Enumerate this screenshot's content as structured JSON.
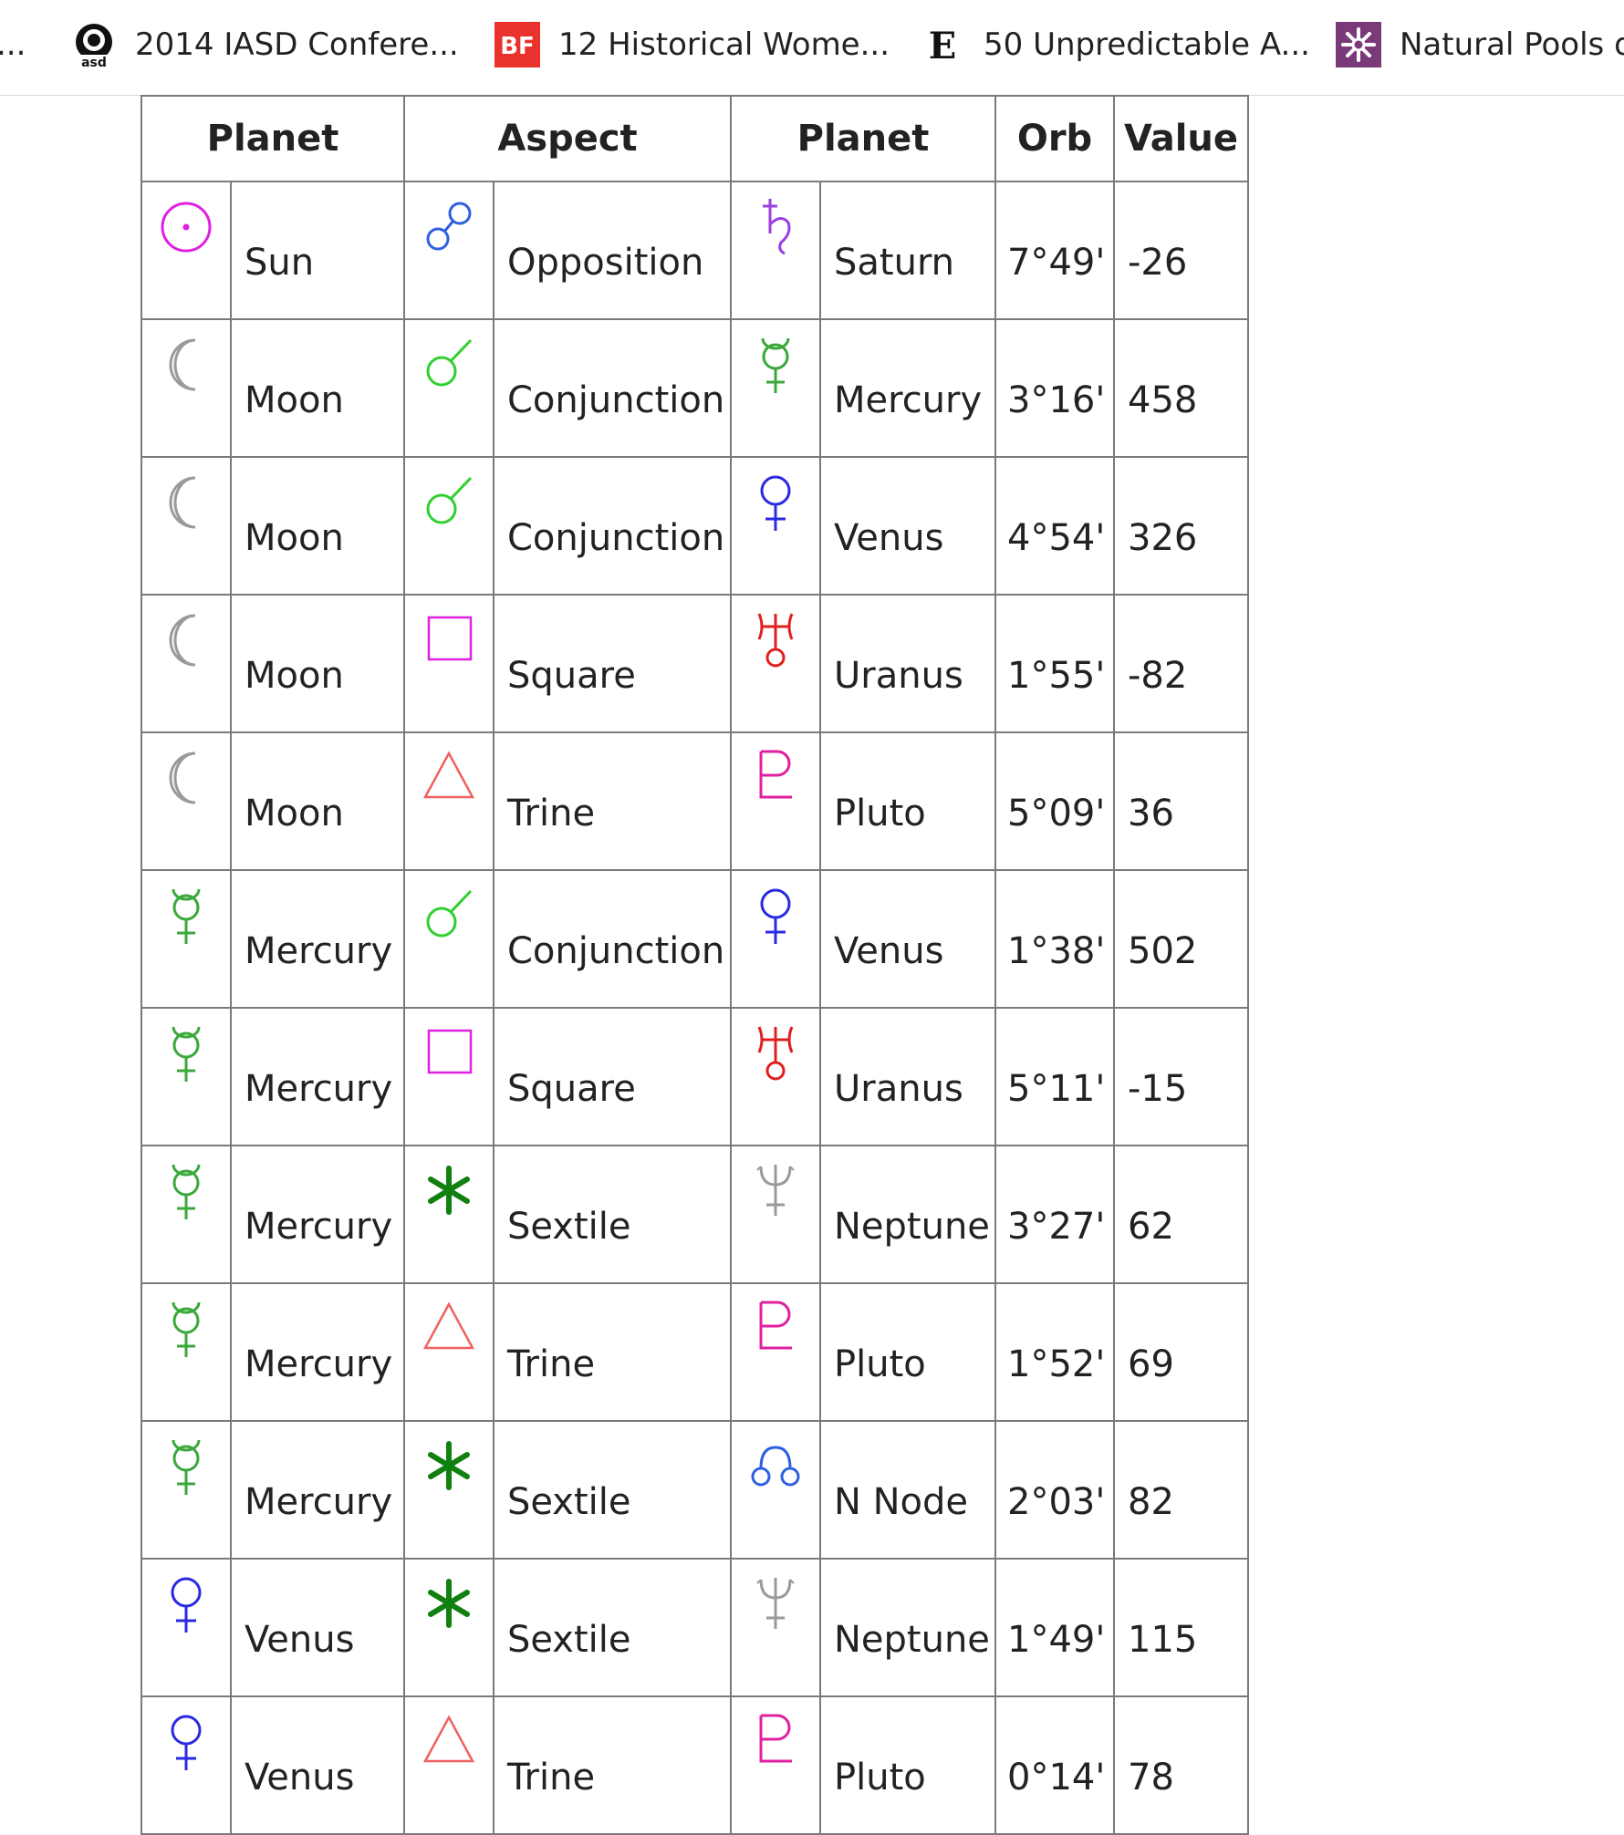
{
  "bookmarks": [
    {
      "label": "...",
      "icon": "partial-bookmark-icon"
    },
    {
      "label": "2014 IASD Confere...",
      "icon": "iasd-logo-icon"
    },
    {
      "label": "12 Historical Wome...",
      "icon": "bf-logo-icon"
    },
    {
      "label": "50 Unpredictable A...",
      "icon": "e-logo-icon"
    },
    {
      "label": "Natural Pools o",
      "icon": "snowflake-logo-icon"
    }
  ],
  "table": {
    "headers": [
      "Planet",
      "Aspect",
      "Planet",
      "Orb",
      "Value"
    ],
    "rows": [
      {
        "p1": "Sun",
        "p1_icon": "sun-icon",
        "aspect": "Opposition",
        "aspect_icon": "opposition-icon",
        "p2": "Saturn",
        "p2_icon": "saturn-icon",
        "orb": "7°49'",
        "value": "-26"
      },
      {
        "p1": "Moon",
        "p1_icon": "moon-icon",
        "aspect": "Conjunction",
        "aspect_icon": "conjunction-icon",
        "p2": "Mercury",
        "p2_icon": "mercury-icon",
        "orb": "3°16'",
        "value": "458"
      },
      {
        "p1": "Moon",
        "p1_icon": "moon-icon",
        "aspect": "Conjunction",
        "aspect_icon": "conjunction-icon",
        "p2": "Venus",
        "p2_icon": "venus-icon",
        "orb": "4°54'",
        "value": "326"
      },
      {
        "p1": "Moon",
        "p1_icon": "moon-icon",
        "aspect": "Square",
        "aspect_icon": "square-icon",
        "p2": "Uranus",
        "p2_icon": "uranus-icon",
        "orb": "1°55'",
        "value": "-82"
      },
      {
        "p1": "Moon",
        "p1_icon": "moon-icon",
        "aspect": "Trine",
        "aspect_icon": "trine-icon",
        "p2": "Pluto",
        "p2_icon": "pluto-icon",
        "orb": "5°09'",
        "value": "36"
      },
      {
        "p1": "Mercury",
        "p1_icon": "mercury-icon",
        "aspect": "Conjunction",
        "aspect_icon": "conjunction-icon",
        "p2": "Venus",
        "p2_icon": "venus-icon",
        "orb": "1°38'",
        "value": "502"
      },
      {
        "p1": "Mercury",
        "p1_icon": "mercury-icon",
        "aspect": "Square",
        "aspect_icon": "square-icon",
        "p2": "Uranus",
        "p2_icon": "uranus-icon",
        "orb": "5°11'",
        "value": "-15"
      },
      {
        "p1": "Mercury",
        "p1_icon": "mercury-icon",
        "aspect": "Sextile",
        "aspect_icon": "sextile-icon",
        "p2": "Neptune",
        "p2_icon": "neptune-icon",
        "orb": "3°27'",
        "value": "62"
      },
      {
        "p1": "Mercury",
        "p1_icon": "mercury-icon",
        "aspect": "Trine",
        "aspect_icon": "trine-icon",
        "p2": "Pluto",
        "p2_icon": "pluto-icon",
        "orb": "1°52'",
        "value": "69"
      },
      {
        "p1": "Mercury",
        "p1_icon": "mercury-icon",
        "aspect": "Sextile",
        "aspect_icon": "sextile-icon",
        "p2": "N Node",
        "p2_icon": "north-node-icon",
        "orb": "2°03'",
        "value": "82"
      },
      {
        "p1": "Venus",
        "p1_icon": "venus-icon",
        "aspect": "Sextile",
        "aspect_icon": "sextile-icon",
        "p2": "Neptune",
        "p2_icon": "neptune-icon",
        "orb": "1°49'",
        "value": "115"
      },
      {
        "p1": "Venus",
        "p1_icon": "venus-icon",
        "aspect": "Trine",
        "aspect_icon": "trine-icon",
        "p2": "Pluto",
        "p2_icon": "pluto-icon",
        "orb": "0°14'",
        "value": "78"
      }
    ]
  },
  "colors": {
    "sun": "#e020e0",
    "moon": "#9a9a9a",
    "mercury": "#3aa83a",
    "venus": "#2a2ae0",
    "saturn": "#9a40e0",
    "uranus": "#e02020",
    "pluto": "#e020a0",
    "neptune": "#9a9a9a",
    "north_node": "#3060e0",
    "opposition": "#3060e0",
    "conjunction": "#30d030",
    "square": "#e020e0",
    "trine": "#f06060",
    "sextile": "#108010"
  }
}
